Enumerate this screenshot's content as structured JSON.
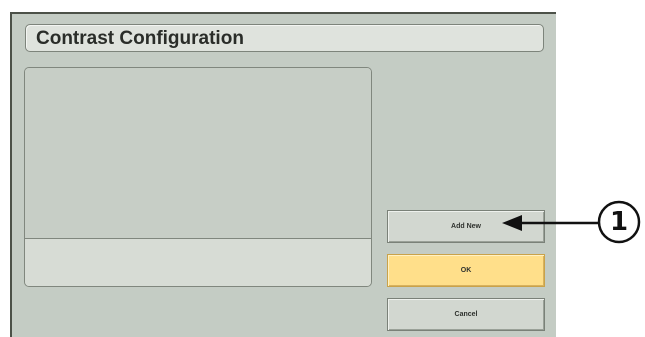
{
  "dialog": {
    "title": "Contrast Configuration"
  },
  "buttons": {
    "add_new": "Add New",
    "ok": "OK",
    "cancel": "Cancel"
  },
  "callout": {
    "number": "1"
  },
  "colors": {
    "panel_background": "#c4ccc4",
    "ok_button": "#ffdf8a",
    "callout_stroke": "#111111"
  }
}
